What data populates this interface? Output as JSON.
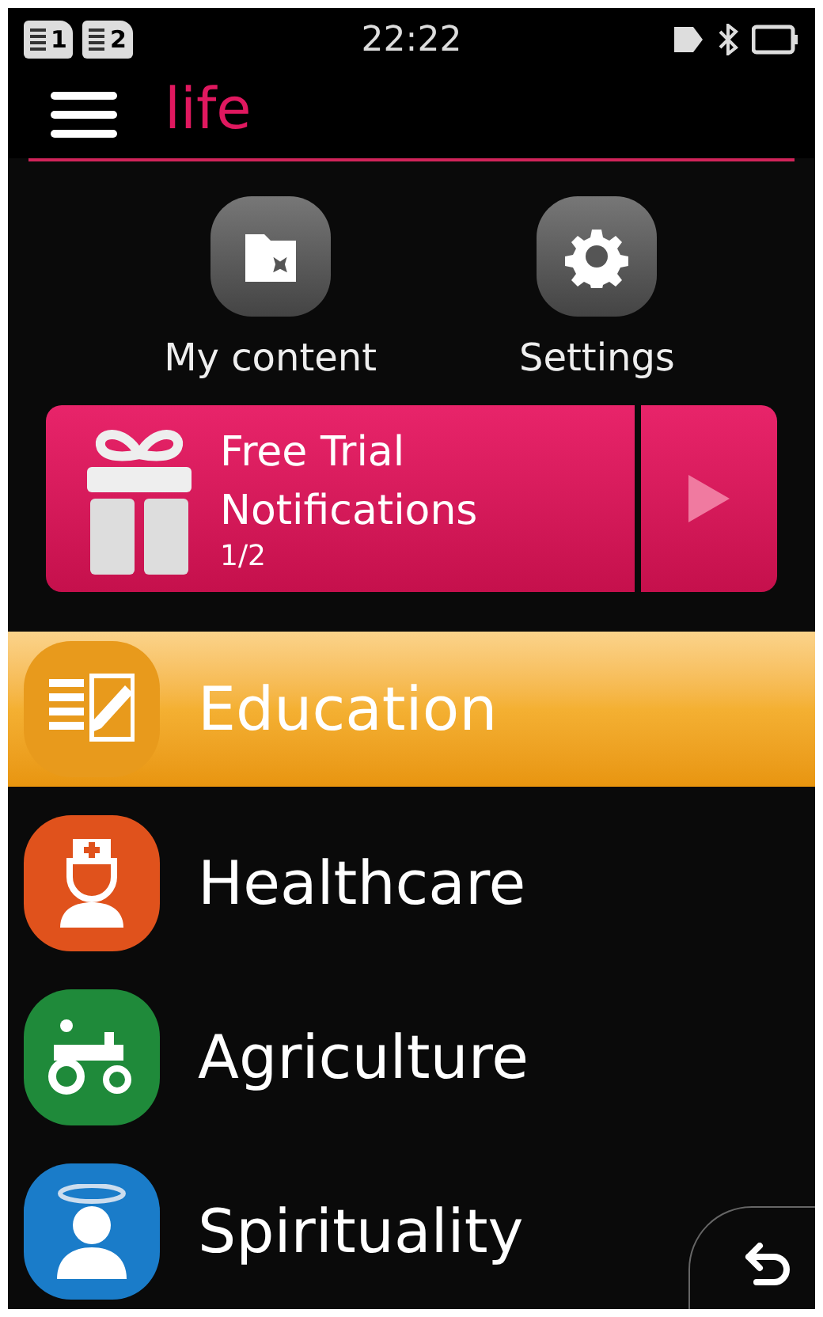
{
  "status_bar": {
    "sims": [
      "1",
      "2"
    ],
    "time": "22:22"
  },
  "header": {
    "title": "life"
  },
  "shortcuts": [
    {
      "kind": "content",
      "label": "My content"
    },
    {
      "kind": "settings",
      "label": "Settings"
    }
  ],
  "banner": {
    "title": "Free Trial",
    "subtitle": "Notifications",
    "counter": "1/2"
  },
  "categories": [
    {
      "kind": "education",
      "label": "Education",
      "color": "#e89a1c",
      "selected": true
    },
    {
      "kind": "healthcare",
      "label": "Healthcare",
      "color": "#e0521c",
      "selected": false
    },
    {
      "kind": "agriculture",
      "label": "Agriculture",
      "color": "#1f8a3a",
      "selected": false
    },
    {
      "kind": "spirituality",
      "label": "Spirituality",
      "color": "#1a7cc9",
      "selected": false
    }
  ]
}
